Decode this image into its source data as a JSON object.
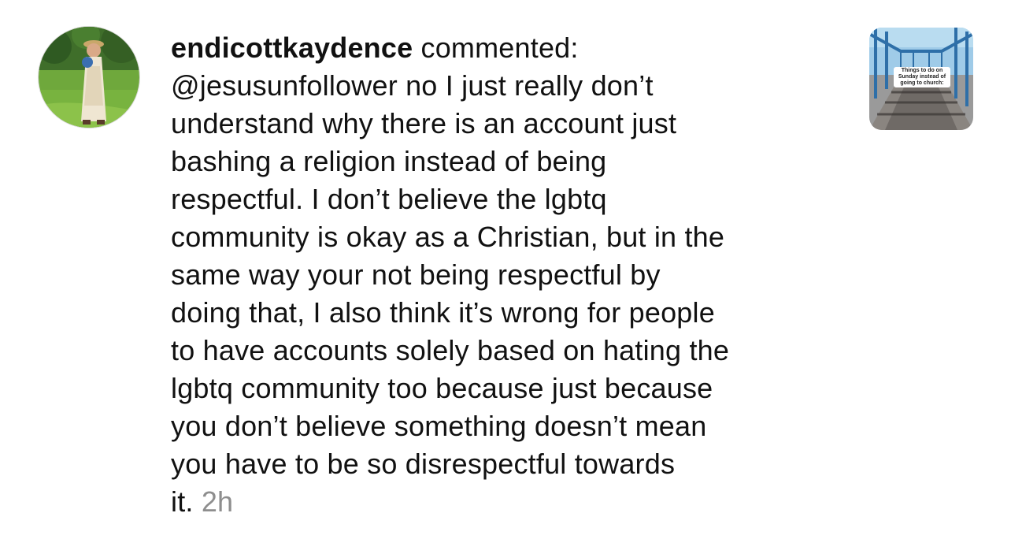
{
  "notification": {
    "username": "endicottkaydence",
    "action": " commented:",
    "comment_lines": [
      "@jesusunfollower no I just really don’t",
      "understand why there is an account just",
      "bashing a religion instead of being",
      "respectful. I don’t believe the lgbtq",
      "community is okay as a Christian, but in the",
      "same way your not being respectful by",
      "doing that, I also think it’s wrong for people",
      "to have accounts solely based on hating the",
      "lgbtq community too because just because",
      "you don’t believe something doesn’t mean",
      "you have to be so disrespectful towards"
    ],
    "last_line": "it. ",
    "timestamp": "2h",
    "avatar_icon": "profile-photo",
    "post_thumbnail": {
      "caption": "Things to do on Sunday instead of going to church:",
      "icon": "bridge-photo"
    }
  }
}
